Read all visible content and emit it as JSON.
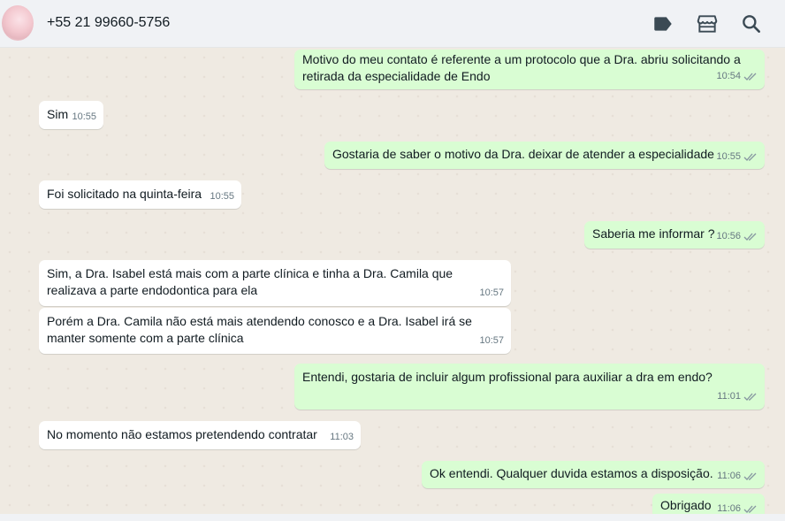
{
  "header": {
    "contact_name": "+55 21 99660-5756"
  },
  "messages": [
    {
      "text": "Motivo do meu contato é referente a um protocolo que a Dra. abriu solicitando a retirada da especialidade de Endo",
      "time": "10:54"
    },
    {
      "text": "Sim",
      "time": "10:55"
    },
    {
      "text": "Gostaria de saber o motivo da Dra. deixar de atender a especialidade",
      "time": "10:55"
    },
    {
      "text": "Foi solicitado na quinta-feira",
      "time": "10:55"
    },
    {
      "text": "Saberia me informar ?",
      "time": "10:56"
    },
    {
      "text": "Sim, a Dra. Isabel está mais com a parte clínica e tinha a Dra. Camila que realizava a parte endodontica para ela",
      "time": "10:57"
    },
    {
      "text": "Porém a Dra. Camila não está mais atendendo conosco e a Dra. Isabel irá se manter somente com a parte clínica",
      "time": "10:57"
    },
    {
      "text": "Entendi, gostaria de incluir algum profissional para auxiliar a dra em endo?",
      "time": "11:01"
    },
    {
      "text": "No momento não estamos pretendendo contratar",
      "time": "11:03"
    },
    {
      "text": "Ok entendi. Qualquer duvida estamos a disposição.",
      "time": "11:06"
    },
    {
      "text": "Obrigado",
      "time": "11:06"
    }
  ],
  "colors": {
    "outgoing_bubble": "#d9fdd3",
    "incoming_bubble": "#ffffff",
    "chat_background": "#efeae2",
    "header_background": "#f0f2f5",
    "read_ticks": "#8696a0"
  },
  "icons": [
    "label-icon",
    "store-icon",
    "search-icon",
    "double-check-icon"
  ]
}
